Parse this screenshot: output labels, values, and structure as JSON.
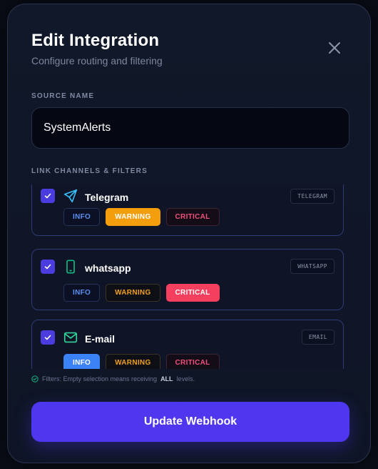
{
  "modal": {
    "title": "Edit Integration",
    "subtitle": "Configure routing and filtering"
  },
  "source": {
    "label": "SOURCE NAME",
    "value": "SystemAlerts"
  },
  "channels_section": {
    "label": "LINK CHANNELS & FILTERS",
    "channels": [
      {
        "name": "Telegram",
        "tag": "TELEGRAM",
        "icon": "send-icon",
        "icon_color": "#38bdf8",
        "checked": true,
        "levels": [
          {
            "label": "INFO",
            "active": false
          },
          {
            "label": "WARNING",
            "active": true
          },
          {
            "label": "CRITICAL",
            "active": false
          }
        ]
      },
      {
        "name": "whatsapp",
        "tag": "WHATSAPP",
        "icon": "phone-icon",
        "icon_color": "#10b981",
        "checked": true,
        "levels": [
          {
            "label": "INFO",
            "active": false
          },
          {
            "label": "WARNING",
            "active": false
          },
          {
            "label": "CRITICAL",
            "active": true
          }
        ]
      },
      {
        "name": "E-mail",
        "tag": "EMAIL",
        "icon": "mail-icon",
        "icon_color": "#34d399",
        "checked": true,
        "levels": [
          {
            "label": "INFO",
            "active": true
          },
          {
            "label": "WARNING",
            "active": false
          },
          {
            "label": "CRITICAL",
            "active": false
          }
        ]
      }
    ]
  },
  "hint": {
    "prefix": "Filters: Empty selection means receiving",
    "emphasis": "ALL",
    "suffix": "levels."
  },
  "submit": {
    "label": "Update Webhook"
  },
  "colors": {
    "accent": "#4f37f0",
    "checkbox": "#4b3ce0",
    "info": "#3b82f6",
    "warning": "#f59e0b",
    "critical": "#f43f5e"
  }
}
